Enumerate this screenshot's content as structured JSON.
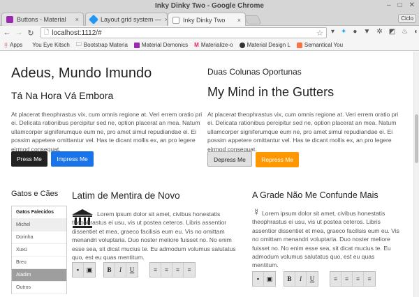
{
  "window": {
    "title": "Inky Dinky Two - Google Chrome",
    "user": "Ciclo"
  },
  "tabs": [
    {
      "label": "Buttons - Material",
      "color": "#9c27b0"
    },
    {
      "label": "Layout grid system —",
      "color": "#2196f3"
    },
    {
      "label": "Inky Dinky Two",
      "color": "#888888"
    }
  ],
  "toolbar": {
    "url": "localhost:1112/#"
  },
  "bookmarks": [
    {
      "label": "Apps",
      "color": "#d0342c"
    },
    {
      "label": "You Eye Kitsch",
      "color": ""
    },
    {
      "label": "Bootstrap Materia",
      "color": "#666666"
    },
    {
      "label": "Material Demonics",
      "color": "#9c27b0"
    },
    {
      "label": "Materialize-o",
      "color": "#e91e63"
    },
    {
      "label": "Material Design L",
      "color": "#333333"
    },
    {
      "label": "Semantical You",
      "color": "#ff7043"
    }
  ],
  "hero_left": {
    "title": "Adeus, Mundo Imundo",
    "subtitle": "Tá Na Hora Vá Embora",
    "body": "At placerat theophrastus vix, cum omnis regione at. Veri errem oratio pri ei. Delicata rationibus percipitur sed ne, option placerat an mea. Natum ullamcorper signiferumque eum ne, pro amet simul repudiandae ei. Ei possim appetere omittantur vel. Has te dicant mollis ex, an pro legere eirmod consequat.",
    "btn_press": "Press Me",
    "btn_impress": "Impress Me"
  },
  "hero_right": {
    "overline": "Duas Colunas Oportunas",
    "title": "My Mind in the Gutters",
    "body": "At placerat theophrastus vix, cum omnis regione at. Veri errem oratio pri ei. Delicata rationibus percipitur sed ne, option placerat an mea. Natum ullamcorper signiferumque eum ne, pro amet simul repudiandae ei. Ei possim appetere omittantur vel. Has te dicant mollis ex, an pro legere eirmod consequat.",
    "btn_depress": "Depress Me",
    "btn_repress": "Repress Me"
  },
  "sidebar": {
    "title": "Gatos e Cães",
    "header": "Gatos Falecidos",
    "items": [
      "Michel",
      "Dorinha",
      "Xuxú",
      "Breu",
      "Aladim",
      "Outros"
    ]
  },
  "section_mid": {
    "title": "Latim de Mentira de Novo",
    "body": "Lorem ipsum dolor sit amet, civibus honestatis theophrastus ei usu, vis ut postea ceteros. Libris assentior dissentiet et mea, graeco facilisis eum eu. Vis no omittam menandri voluptaria. Duo noster meliore fuisset no. No enim esse sea, sit dicat mucius te. Eu admodum volumus salutatus quo, est eu quas mentitum."
  },
  "section_right": {
    "title": "A Grade Não Me Confunde Mais",
    "body": "Lorem ipsum dolor sit amet, civibus honestatis theophrastus ei usu, vis ut postea ceteros. Libris assentior dissentiet et mea, graeco facilisis eum eu. Vis no omittam menandri voluptaria. Duo noster meliore fuisset no. No enim esse sea, sit dicat mucius te. Eu admodum volumus salutatus quo, est eu quas mentitum."
  },
  "editor": {
    "bold": "B",
    "italic": "I",
    "underline": "U"
  }
}
